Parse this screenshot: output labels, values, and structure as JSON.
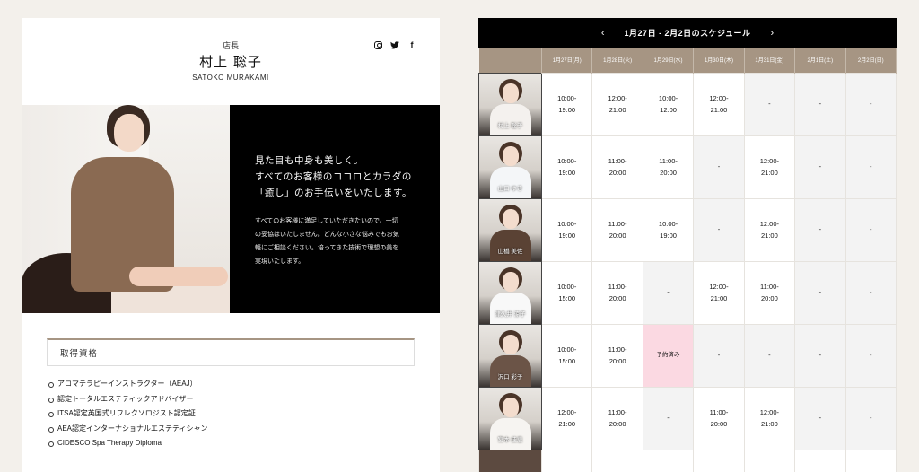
{
  "profile": {
    "role": "店長",
    "name_ja": "村上 聡子",
    "name_en": "SATOKO MURAKAMI",
    "socials": [
      {
        "name": "instagram-icon",
        "glyph": ""
      },
      {
        "name": "twitter-icon",
        "glyph": "🐦"
      },
      {
        "name": "facebook-icon",
        "glyph": "f"
      }
    ],
    "lead_lines": [
      "見た目も中身も美しく。",
      "すべてのお客様のココロとカラダの",
      "「癒し」のお手伝いをいたします。"
    ],
    "body_lines": [
      "すべてのお客様に満足していただきたいので、一切",
      "の妥協はいたしません。どんな小さな悩みでもお気",
      "軽にご相談ください。培ってきた技術で理想の美を",
      "実現いたします。"
    ],
    "qual_title": "取得資格",
    "qualifications": [
      "アロマテラピーインストラクター（AEAJ）",
      "認定トータルエステティックアドバイザー",
      "ITSA認定英国式リフレクソロジスト認定証",
      "AEA認定インターナショナルエステティシャン",
      "CIDESCO Spa Therapy Diploma"
    ]
  },
  "schedule": {
    "title": "1月27日 - 2月2日のスケジュール",
    "prev": "‹",
    "next": "›",
    "days": [
      "1月27日(月)",
      "1月28日(火)",
      "1月29日(水)",
      "1月30日(木)",
      "1月31日(金)",
      "2月1日(土)",
      "2月2日(日)"
    ],
    "rows": [
      {
        "staff": "村上 聡子",
        "cells": [
          "10:00-\n19:00",
          "12:00-\n21:00",
          "10:00-\n12:00",
          "12:00-\n21:00",
          "-",
          "-",
          "-"
        ]
      },
      {
        "staff": "山口 ゆき",
        "cells": [
          "10:00-\n19:00",
          "11:00-\n20:00",
          "11:00-\n20:00",
          "-",
          "12:00-\n21:00",
          "-",
          "-"
        ]
      },
      {
        "staff": "山橋 美佐",
        "cells": [
          "10:00-\n19:00",
          "11:00-\n20:00",
          "10:00-\n19:00",
          "-",
          "12:00-\n21:00",
          "-",
          "-"
        ]
      },
      {
        "staff": "津久井 涼子",
        "cells": [
          "10:00-\n15:00",
          "11:00-\n20:00",
          "-",
          "12:00-\n21:00",
          "11:00-\n20:00",
          "-",
          "-"
        ]
      },
      {
        "staff": "沢口 彩子",
        "cells": [
          "10:00-\n15:00",
          "11:00-\n20:00",
          "予約済み",
          "-",
          "-",
          "-",
          "-"
        ]
      },
      {
        "staff": "宮本 佳恵",
        "cells": [
          "12:00-\n21:00",
          "11:00-\n20:00",
          "-",
          "11:00-\n20:00",
          "12:00-\n21:00",
          "-",
          "-"
        ]
      }
    ]
  },
  "colors": {
    "accent": "#a69583",
    "booked": "#fbd9e2",
    "header": "#000000"
  }
}
